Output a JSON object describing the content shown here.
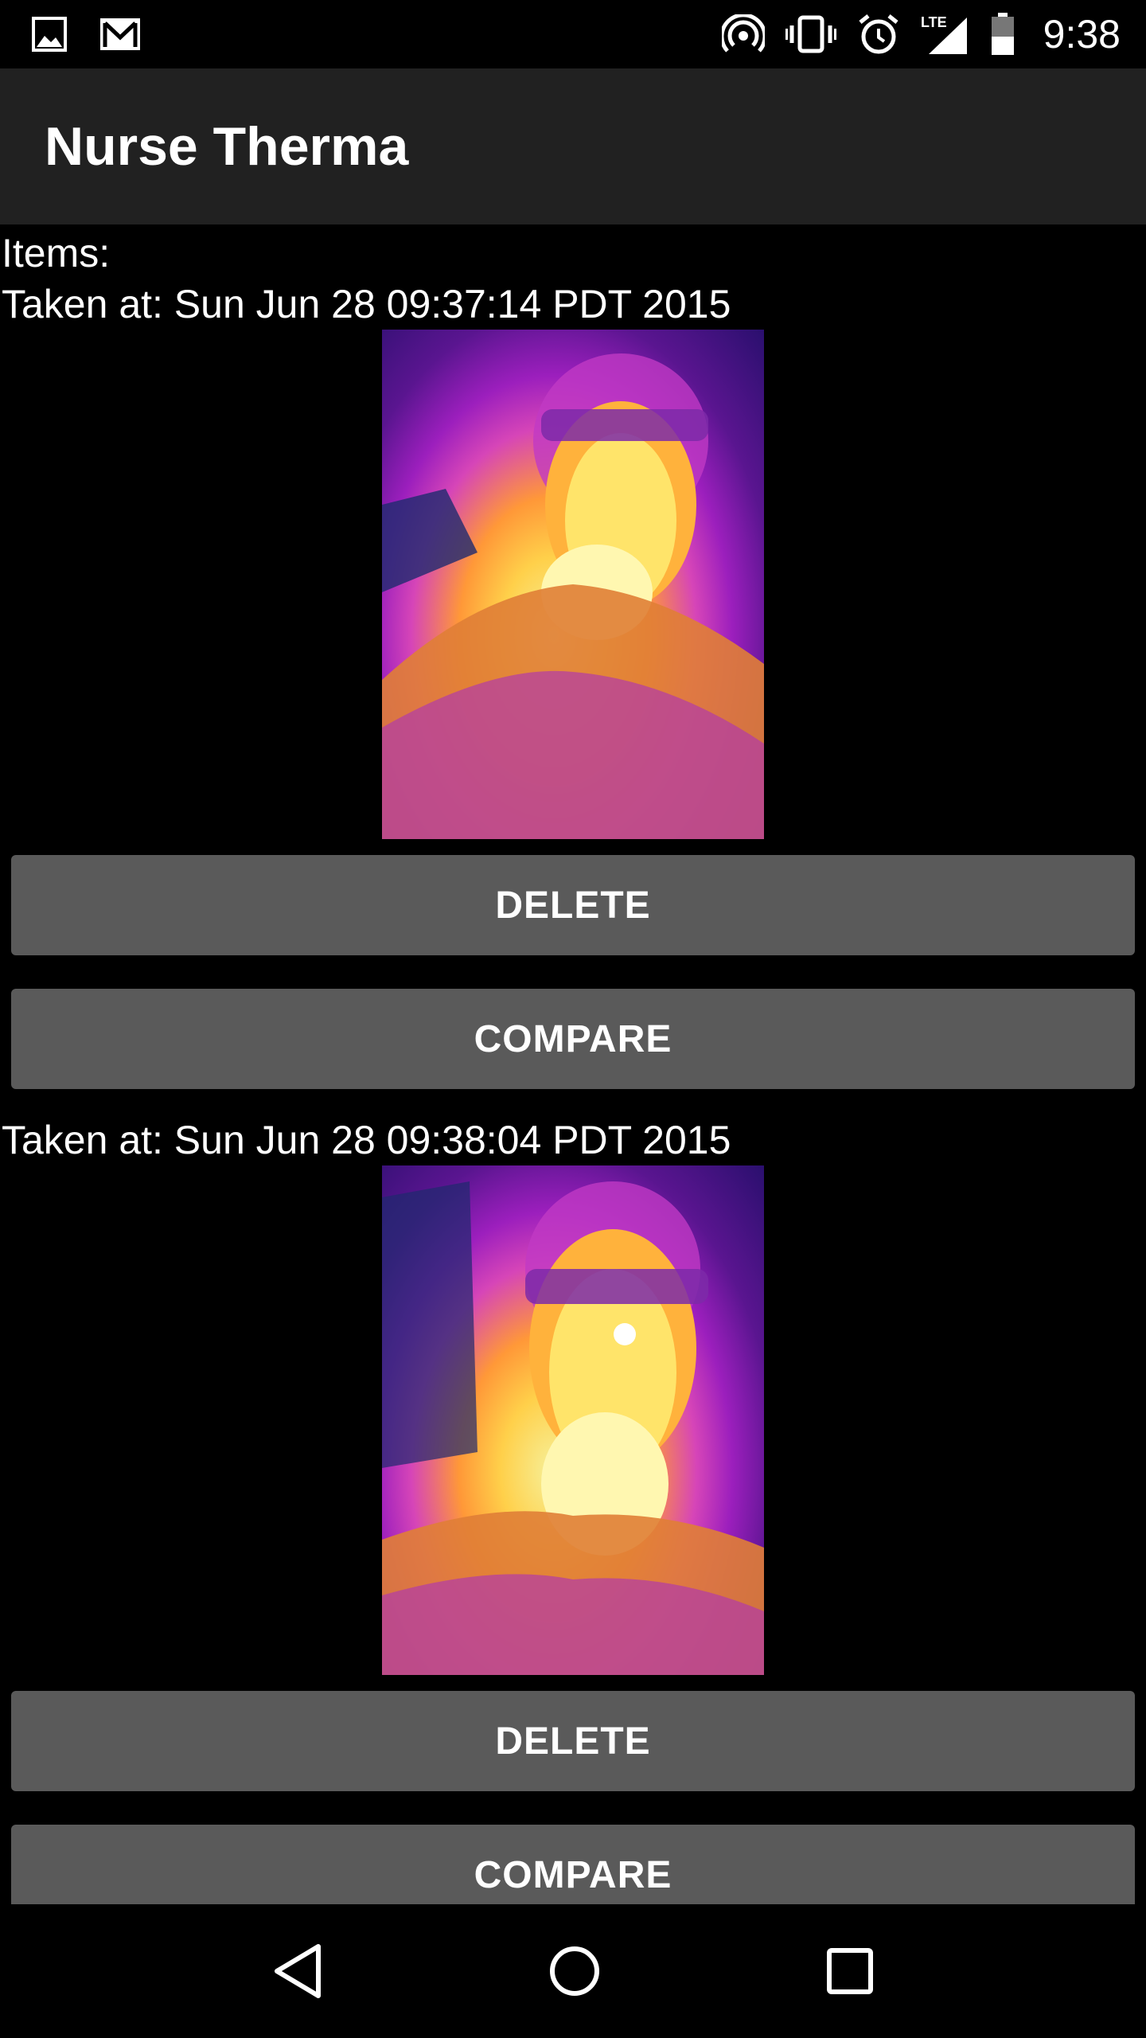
{
  "status_bar": {
    "time": "9:38",
    "network": "LTE",
    "left_icons": [
      "image-icon",
      "gmail-icon"
    ],
    "right_icons": [
      "hotspot-icon",
      "vibrate-icon",
      "alarm-icon",
      "signal-icon",
      "battery-icon"
    ]
  },
  "app_bar": {
    "title": "Nurse Therma"
  },
  "list": {
    "header": "Items:",
    "entries": [
      {
        "taken_at": "Taken at: Sun Jun 28 09:37:14 PDT 2015",
        "delete_label": "DELETE",
        "compare_label": "COMPARE"
      },
      {
        "taken_at": "Taken at: Sun Jun 28 09:38:04 PDT 2015",
        "delete_label": "DELETE",
        "compare_label": "COMPARE"
      }
    ]
  },
  "nav_bar": {
    "icons": [
      "back-icon",
      "home-icon",
      "recents-icon"
    ]
  }
}
